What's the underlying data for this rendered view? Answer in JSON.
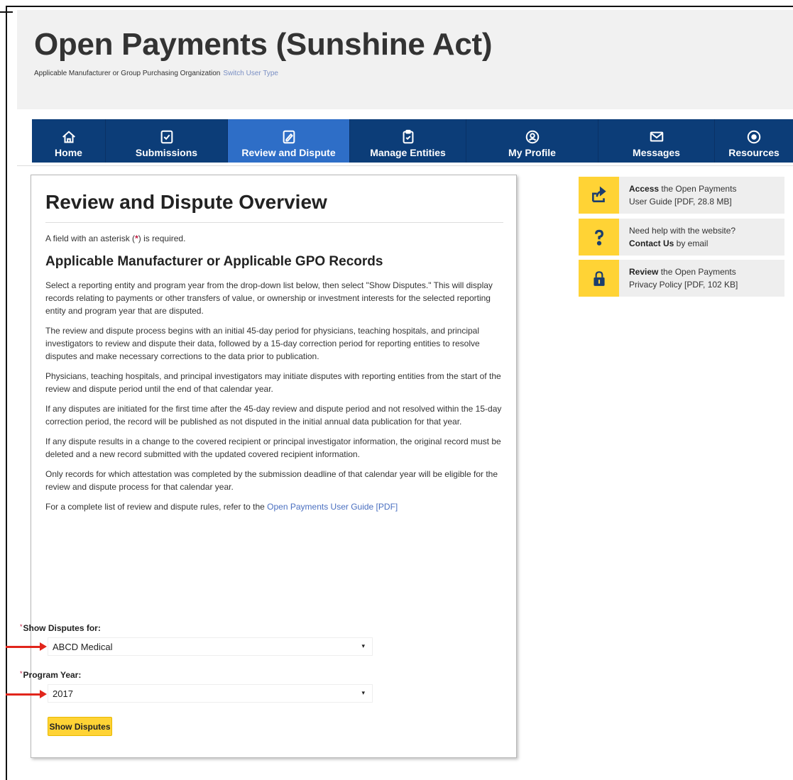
{
  "header": {
    "site_title": "Open Payments (Sunshine Act)",
    "user_type": "Applicable Manufacturer or Group Purchasing Organization",
    "switch_link": "Switch User Type"
  },
  "nav": {
    "items": [
      {
        "label": "Home",
        "icon": "home-icon"
      },
      {
        "label": "Submissions",
        "icon": "checklist-icon"
      },
      {
        "label": "Review and Dispute",
        "icon": "edit-icon"
      },
      {
        "label": "Manage Entities",
        "icon": "clipboard-icon"
      },
      {
        "label": "My Profile",
        "icon": "user-icon"
      },
      {
        "label": "Messages",
        "icon": "envelope-icon"
      },
      {
        "label": "Resources",
        "icon": "gear-icon"
      }
    ],
    "active": "Review and Dispute"
  },
  "main": {
    "title": "Review and Dispute Overview",
    "required_note_pre": "A field with an asterisk (",
    "required_note_ast": "*",
    "required_note_post": ") is required.",
    "subtitle": "Applicable Manufacturer or Applicable GPO Records",
    "paragraphs": [
      "Select a reporting entity and program year from the drop-down list below, then select \"Show Disputes.\" This will display records relating to payments or other transfers of value, or ownership or investment interests for the selected reporting entity and program year that are disputed.",
      "The review and dispute process begins with an initial 45-day period for physicians, teaching hospitals, and principal investigators to review and dispute their data, followed by a 15-day correction period for reporting entities to resolve disputes and make necessary corrections to the data prior to publication.",
      "Physicians, teaching hospitals, and principal investigators may initiate disputes with reporting entities from the start of the review and dispute period until the end of that calendar year.",
      "If any disputes are initiated for the first time after the 45-day review and dispute period and not resolved within the 15-day correction period, the record will be published as not disputed in the initial annual data publication for that year.",
      "If any dispute results in a change to the covered recipient or principal investigator information, the original record must be deleted and a new record submitted with the updated covered recipient information.",
      "Only records for which attestation was completed by the submission deadline of that calendar year will be eligible for the review and dispute process for that calendar year."
    ],
    "rules_pre": "For a complete list of review and dispute rules, refer to the ",
    "rules_link": "Open Payments User Guide [PDF]",
    "show_disputes_label": "Show Disputes for:",
    "show_disputes_value": "ABCD Medical",
    "program_year_label": "Program Year:",
    "program_year_value": "2017",
    "button_label": "Show Disputes",
    "asterisk": "*",
    "caret": "▾"
  },
  "sidebar": {
    "cards": [
      {
        "bold": "Access",
        "text1": " the Open Payments",
        "text2": "User Guide [PDF, 28.8 MB]",
        "icon": "share-arrow-icon"
      },
      {
        "text1": "Need help with the website?",
        "bold": "Contact Us",
        "text2": " by email",
        "icon": "question-icon"
      },
      {
        "bold": "Review",
        "text1": " the Open Payments",
        "text2": "Privacy Policy [PDF, 102 KB]",
        "icon": "lock-icon"
      }
    ]
  },
  "colors": {
    "nav_bg": "#0c3d78",
    "nav_active": "#2e6ec7",
    "accent_yellow": "#ffd335",
    "arrow_red": "#e1251b",
    "link_blue": "#4a6fc0"
  }
}
